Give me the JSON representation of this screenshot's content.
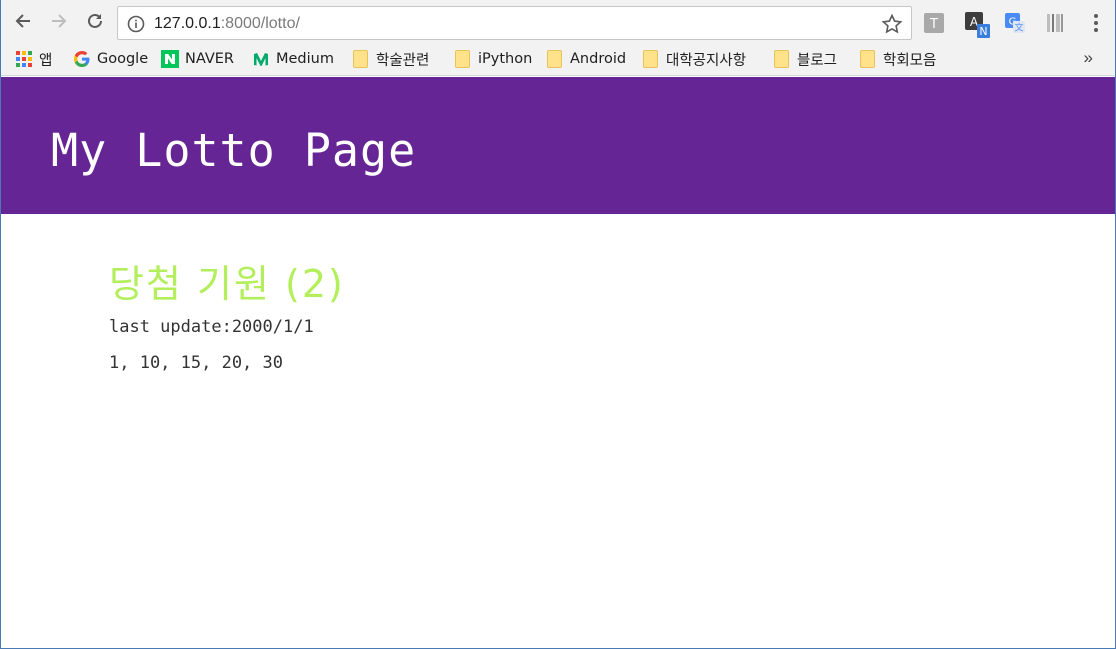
{
  "browser": {
    "url_host": "127.0.0.1",
    "url_path": ":8000/lotto/",
    "icons": {
      "back": "back-arrow-icon",
      "forward": "forward-arrow-icon",
      "reload": "reload-icon",
      "info": "info-icon",
      "bookmark_star": "star-icon",
      "menu": "kebab-menu-icon"
    },
    "extensions": [
      "text-extension-icon",
      "translate-n-extension-icon",
      "google-translate-icon",
      "barcode-extension-icon"
    ]
  },
  "bookmarks": [
    {
      "label": "앱",
      "icon": "apps-grid-icon"
    },
    {
      "label": "Google",
      "icon": "google-icon"
    },
    {
      "label": "NAVER",
      "icon": "naver-icon"
    },
    {
      "label": "Medium",
      "icon": "medium-icon"
    },
    {
      "label": "학술관련",
      "icon": "folder-icon"
    },
    {
      "label": "iPython",
      "icon": "folder-icon"
    },
    {
      "label": "Android",
      "icon": "folder-icon"
    },
    {
      "label": "대학공지사항",
      "icon": "folder-icon"
    },
    {
      "label": "블로그",
      "icon": "folder-icon"
    },
    {
      "label": "학회모음",
      "icon": "folder-icon"
    }
  ],
  "bookmarks_more": "»",
  "page": {
    "title": "My Lotto Page",
    "heading": "당첨 기원 (2)",
    "last_update": "last update:2000/1/1",
    "numbers": "1, 10, 15, 20, 30"
  },
  "colors": {
    "header_bg": "#662594",
    "heading_color": "#b2ef5a"
  }
}
